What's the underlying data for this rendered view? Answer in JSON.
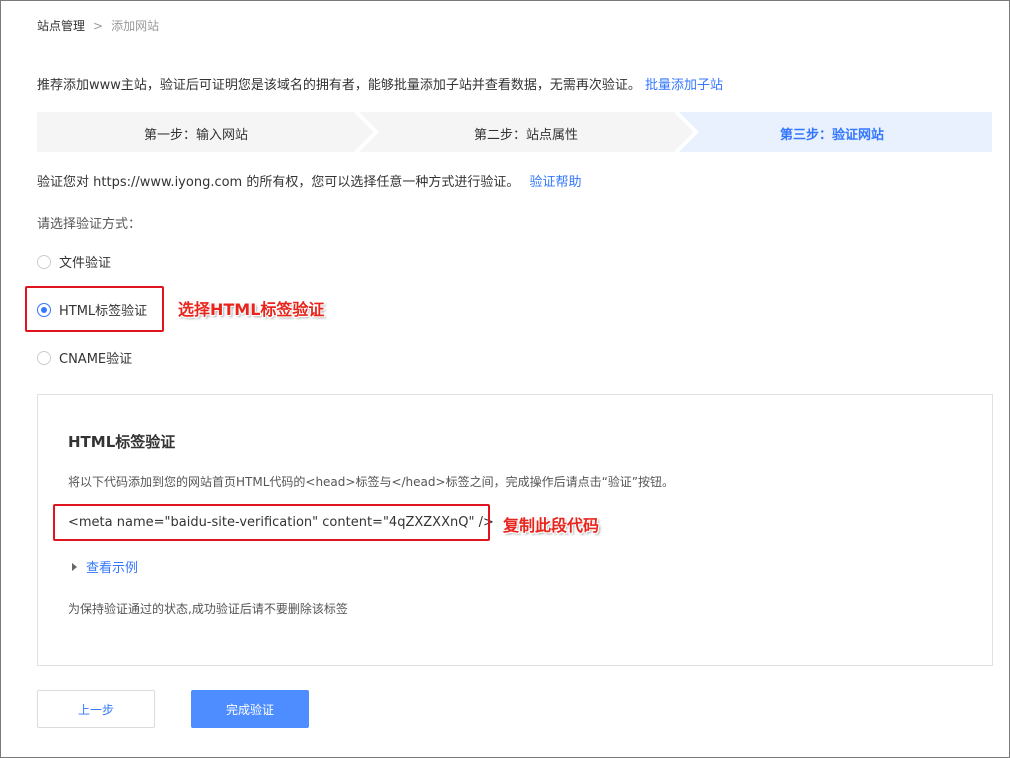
{
  "breadcrumb": {
    "root": "站点管理",
    "separator": ">",
    "current": "添加网站"
  },
  "intro": {
    "text": "推荐添加www主站，验证后可证明您是该域名的拥有者，能够批量添加子站并查看数据，无需再次验证。",
    "link": "批量添加子站"
  },
  "steps": [
    {
      "label": "第一步：输入网站",
      "active": false
    },
    {
      "label": "第二步：站点属性",
      "active": false
    },
    {
      "label": "第三步：验证网站",
      "active": true
    }
  ],
  "verify": {
    "desc": "验证您对 https://www.iyong.com 的所有权，您可以选择任意一种方式进行验证。",
    "help_link": "验证帮助",
    "choose_label": "请选择验证方式："
  },
  "methods": [
    {
      "label": "文件验证",
      "checked": false
    },
    {
      "label": "HTML标签验证",
      "checked": true
    },
    {
      "label": "CNAME验证",
      "checked": false
    }
  ],
  "annotations": {
    "select_html": "选择HTML标签验证",
    "copy_code": "复制此段代码"
  },
  "panel": {
    "title": "HTML标签验证",
    "desc": "将以下代码添加到您的网站首页HTML代码的<head>标签与</head>标签之间，完成操作后请点击“验证”按钮。",
    "code": "<meta name=\"baidu-site-verification\" content=\"4qZXZXXnQ\" />",
    "example_link": "查看示例",
    "keep_note": "为保持验证通过的状态,成功验证后请不要删除该标签"
  },
  "buttons": {
    "prev": "上一步",
    "done": "完成验证"
  },
  "colors": {
    "accent": "#3377ff",
    "primary_button": "#4e8dff",
    "annotation_red": "#e0141e",
    "step_bg": "#f5f5f5",
    "step_active_bg": "#e9f1ff"
  }
}
